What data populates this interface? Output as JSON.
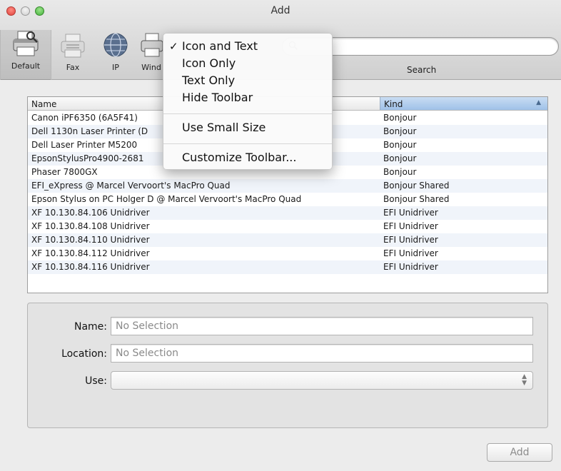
{
  "window": {
    "title": "Add"
  },
  "toolbar": {
    "items": [
      {
        "label": "Default",
        "icon": "printer-icon"
      },
      {
        "label": "Fax",
        "icon": "fax-icon"
      },
      {
        "label": "IP",
        "icon": "globe-icon"
      },
      {
        "label": "Wind",
        "icon": "windows-printer-icon"
      }
    ],
    "search_label": "Search",
    "search_placeholder": ""
  },
  "context_menu": {
    "checkmark": "✓",
    "items": [
      {
        "label": "Icon and Text",
        "checked": true
      },
      {
        "label": "Icon Only"
      },
      {
        "label": "Text Only"
      },
      {
        "label": "Hide Toolbar"
      },
      {
        "label": "Use Small Size"
      },
      {
        "label": "Customize Toolbar..."
      }
    ]
  },
  "table": {
    "headers": {
      "name": "Name",
      "kind": "Kind"
    },
    "sort_indicator": "▲",
    "rows": [
      {
        "name": "Canon iPF6350 (6A5F41)",
        "kind": "Bonjour"
      },
      {
        "name": "Dell 1130n Laser Printer (D",
        "kind": "Bonjour"
      },
      {
        "name": "Dell Laser Printer M5200",
        "kind": "Bonjour"
      },
      {
        "name": "EpsonStylusPro4900-2681",
        "kind": "Bonjour"
      },
      {
        "name": "Phaser 7800GX",
        "kind": "Bonjour"
      },
      {
        "name": "EFI_eXpress @ Marcel Vervoort's MacPro Quad",
        "kind": "Bonjour Shared"
      },
      {
        "name": "Epson Stylus on PC Holger D @ Marcel Vervoort's MacPro Quad",
        "kind": "Bonjour Shared"
      },
      {
        "name": "XF 10.130.84.106 Unidriver",
        "kind": "EFI Unidriver"
      },
      {
        "name": "XF 10.130.84.108 Unidriver",
        "kind": "EFI Unidriver"
      },
      {
        "name": "XF 10.130.84.110 Unidriver",
        "kind": "EFI Unidriver"
      },
      {
        "name": "XF 10.130.84.112 Unidriver",
        "kind": "EFI Unidriver"
      },
      {
        "name": "XF 10.130.84.116 Unidriver",
        "kind": "EFI Unidriver"
      }
    ]
  },
  "details": {
    "name_label": "Name:",
    "name_value": "No Selection",
    "location_label": "Location:",
    "location_value": "No Selection",
    "use_label": "Use:",
    "use_value": ""
  },
  "buttons": {
    "add": "Add"
  }
}
